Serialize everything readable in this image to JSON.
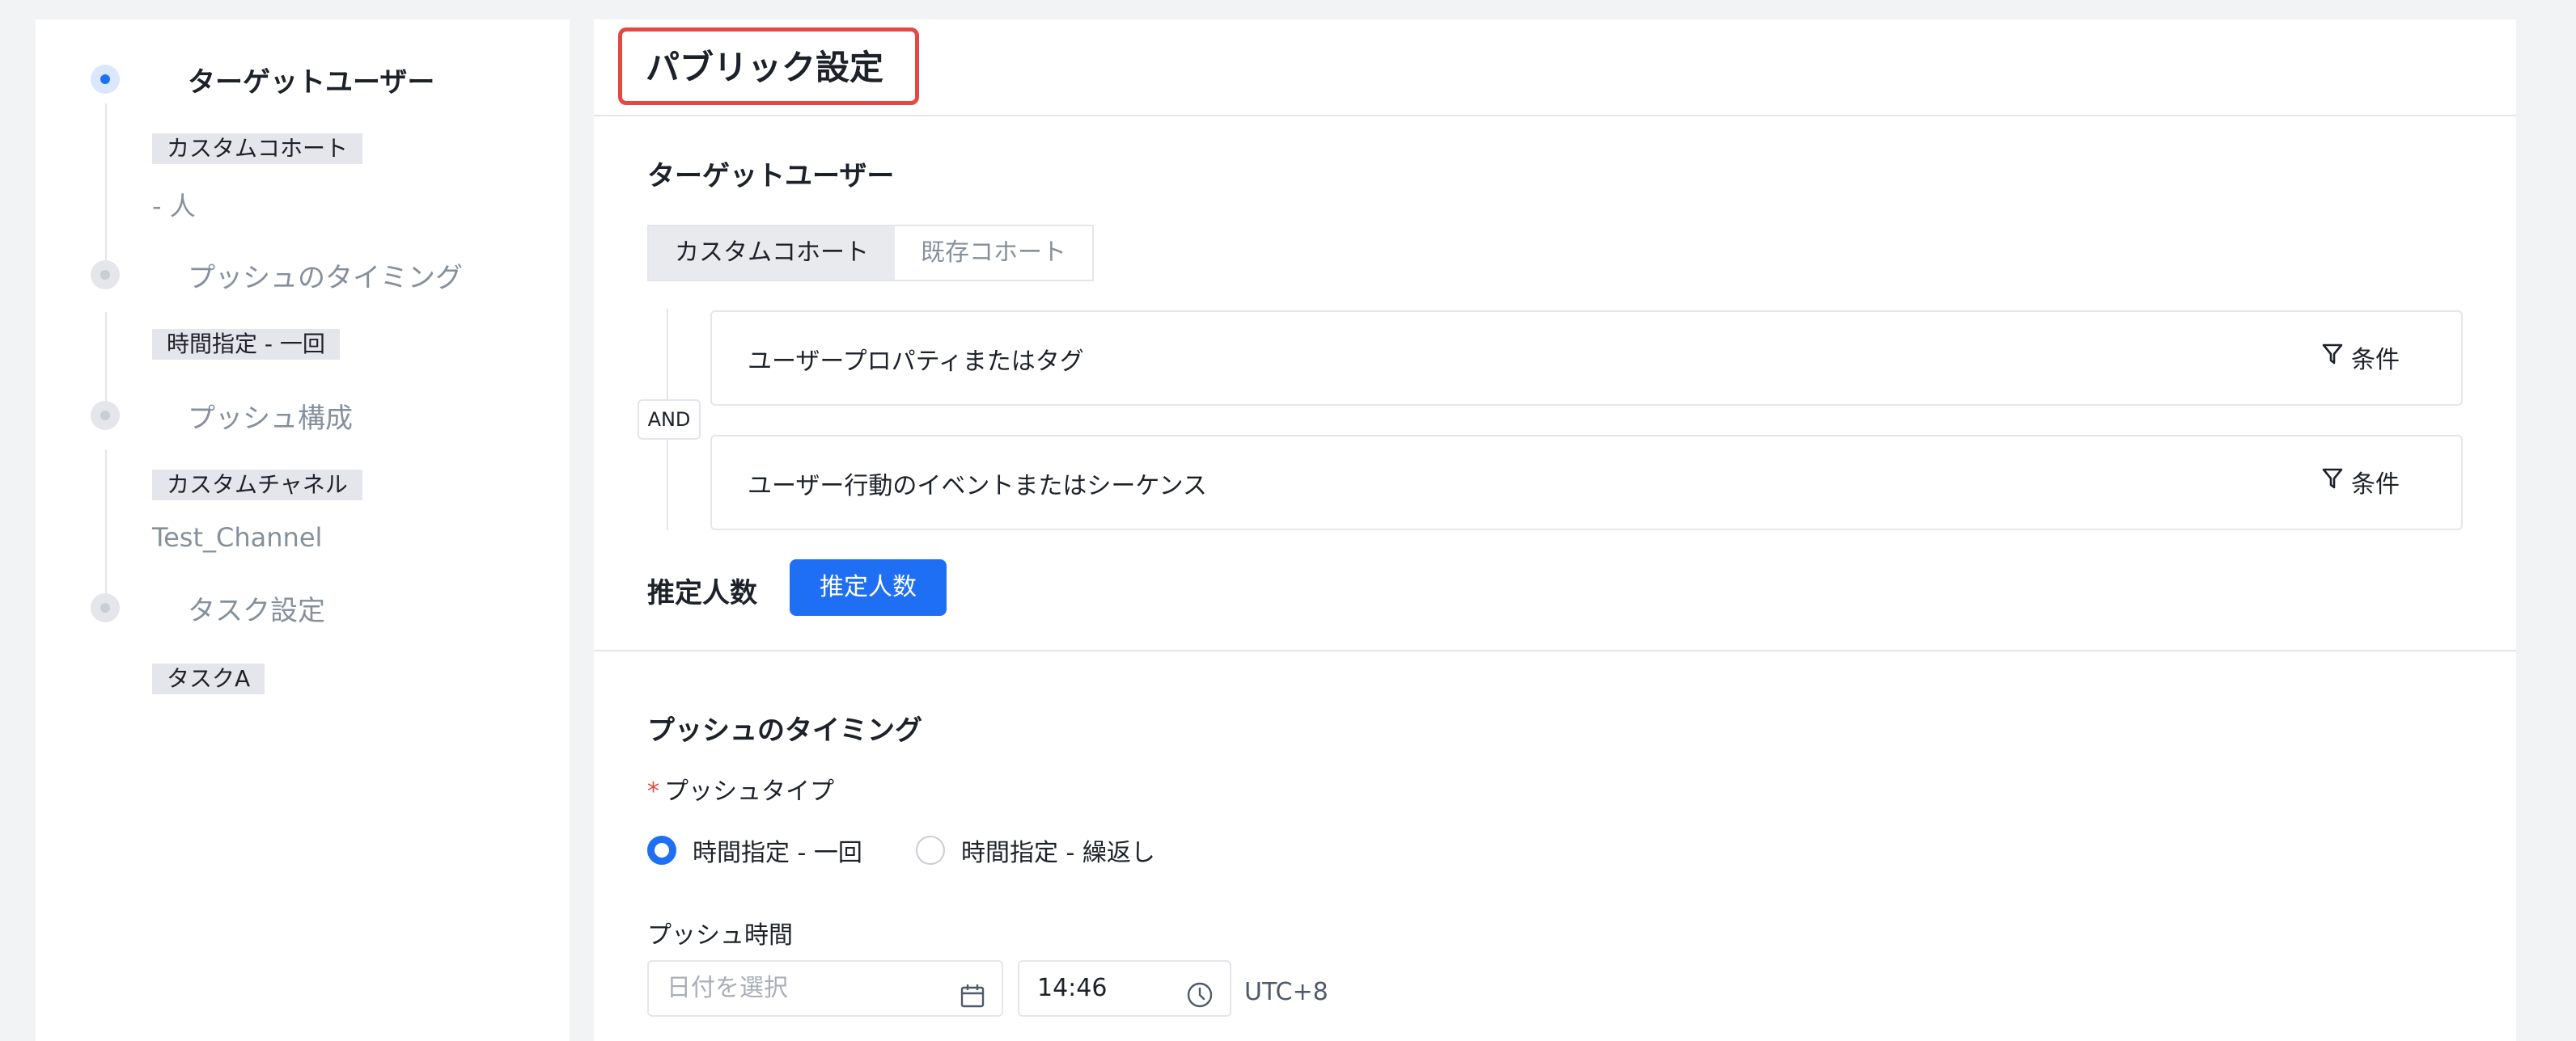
{
  "sidebar": {
    "steps": [
      {
        "title": "ターゲットユーザー",
        "tag": "カスタムコホート",
        "sub": "- 人",
        "active": true
      },
      {
        "title": "プッシュのタイミング",
        "tag": "時間指定 - 一回",
        "sub": ""
      },
      {
        "title": "プッシュ構成",
        "tag": "カスタムチャネル",
        "sub": "Test_Channel"
      },
      {
        "title": "タスク設定",
        "tag": "タスクA",
        "sub": ""
      }
    ]
  },
  "main": {
    "page_title": "パブリック設定",
    "target": {
      "title": "ターゲットユーザー",
      "tabs": [
        "カスタムコホート",
        "既存コホート"
      ],
      "and_label": "AND",
      "conditions": [
        {
          "label": "ユーザープロパティまたはタグ",
          "button": "条件"
        },
        {
          "label": "ユーザー行動のイベントまたはシーケンス",
          "button": "条件"
        }
      ],
      "estimate_label": "推定人数",
      "estimate_button": "推定人数"
    },
    "timing": {
      "title": "プッシュのタイミング",
      "push_type_required": "*",
      "push_type_label": "プッシュタイプ",
      "options": [
        "時間指定 - 一回",
        "時間指定 - 繰返し"
      ],
      "push_time_label": "プッシュ時間",
      "date_placeholder": "日付を選択",
      "time_value": "14:46",
      "timezone": "UTC+8"
    }
  },
  "colors": {
    "accent": "#1f6ff5",
    "highlight": "#e5483f"
  }
}
